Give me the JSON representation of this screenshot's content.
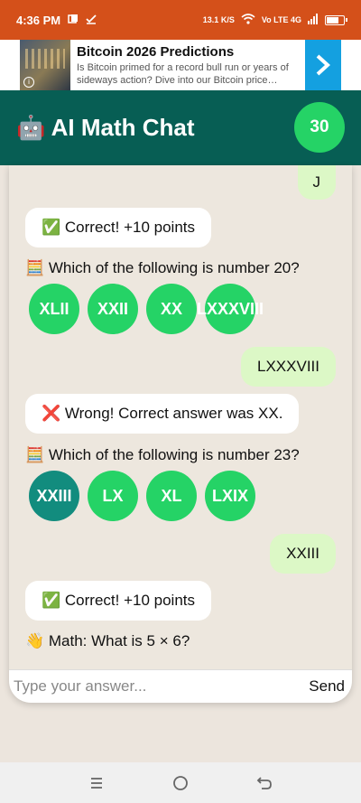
{
  "status": {
    "time": "4:36 PM",
    "net_speed": "13.1 K/S",
    "network": "Vo LTE 4G",
    "battery_level": 0.75
  },
  "ad": {
    "title": "Bitcoin 2026 Predictions",
    "description": "Is Bitcoin primed for a record bull run or years of sideways action? Dive into our Bitcoin price…",
    "info_icon": "i",
    "arrow_icon": "chevron-right"
  },
  "header": {
    "title": "🤖 AI Math Chat",
    "score": "30"
  },
  "messages": {
    "m1": "J",
    "m2": "✅ Correct! +10 points",
    "m3": "🧮 Which of the following is number 20?",
    "q1_options": [
      "XLII",
      "XXII",
      "XX",
      "LXXXVIII"
    ],
    "m4": "LXXXVIII",
    "m5": "❌ Wrong! Correct answer was XX.",
    "m6": "🧮 Which of the following is number 23?",
    "q2_options": [
      "XXIII",
      "LX",
      "XL",
      "LXIX"
    ],
    "m7": "XXIII",
    "m8": "✅ Correct! +10 points",
    "m9": "👋 Math: What is 5 × 6?"
  },
  "input": {
    "placeholder": "Type your answer...",
    "value": "",
    "send_label": "Send"
  },
  "colors": {
    "status_bar": "#d4501a",
    "header": "#075e54",
    "accent": "#25d366",
    "selected_option": "#128c7e",
    "user_bubble": "#dcf8c6"
  }
}
